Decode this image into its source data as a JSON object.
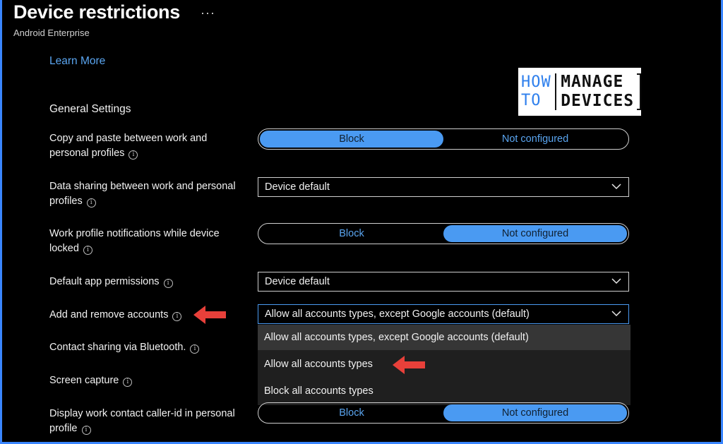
{
  "header": {
    "title": "Device restrictions",
    "more": "···",
    "subtitle": "Android Enterprise"
  },
  "learn_more": "Learn More",
  "logo": {
    "line1": "HOW",
    "line2": "TO",
    "line3": "MANAGE",
    "line4": "DEVICES"
  },
  "section_title": "General Settings",
  "settings": {
    "copy_paste": {
      "label_line1": "Copy and paste between work and",
      "label_line2": "personal profiles",
      "options": [
        "Block",
        "Not configured"
      ],
      "selected": "Block"
    },
    "data_sharing": {
      "label_line1": "Data sharing between work and personal",
      "label_line2": "profiles",
      "value": "Device default"
    },
    "work_notifications": {
      "label_line1": "Work profile notifications while device",
      "label_line2": "locked",
      "options": [
        "Block",
        "Not configured"
      ],
      "selected": "Not configured"
    },
    "default_app_permissions": {
      "label": "Default app permissions",
      "value": "Device default"
    },
    "add_remove_accounts": {
      "label": "Add and remove accounts",
      "value": "Allow all accounts types, except Google accounts (default)",
      "options": [
        "Allow all accounts types, except Google accounts (default)",
        "Allow all accounts types",
        "Block all accounts types"
      ]
    },
    "contact_sharing": {
      "label": "Contact sharing via Bluetooth."
    },
    "screen_capture": {
      "label": "Screen capture"
    },
    "caller_id": {
      "label_line1": "Display work contact caller-id in personal",
      "label_line2": "profile",
      "options": [
        "Block",
        "Not configured"
      ],
      "selected": "Not configured"
    }
  },
  "colors": {
    "accent": "#4a9af2",
    "annotation_arrow": "#e8403a",
    "frame_border": "#3a86ff"
  },
  "icons": {
    "info": "info-circle-icon",
    "chevron": "chevron-down-icon",
    "arrow": "red-arrow-left-icon"
  }
}
